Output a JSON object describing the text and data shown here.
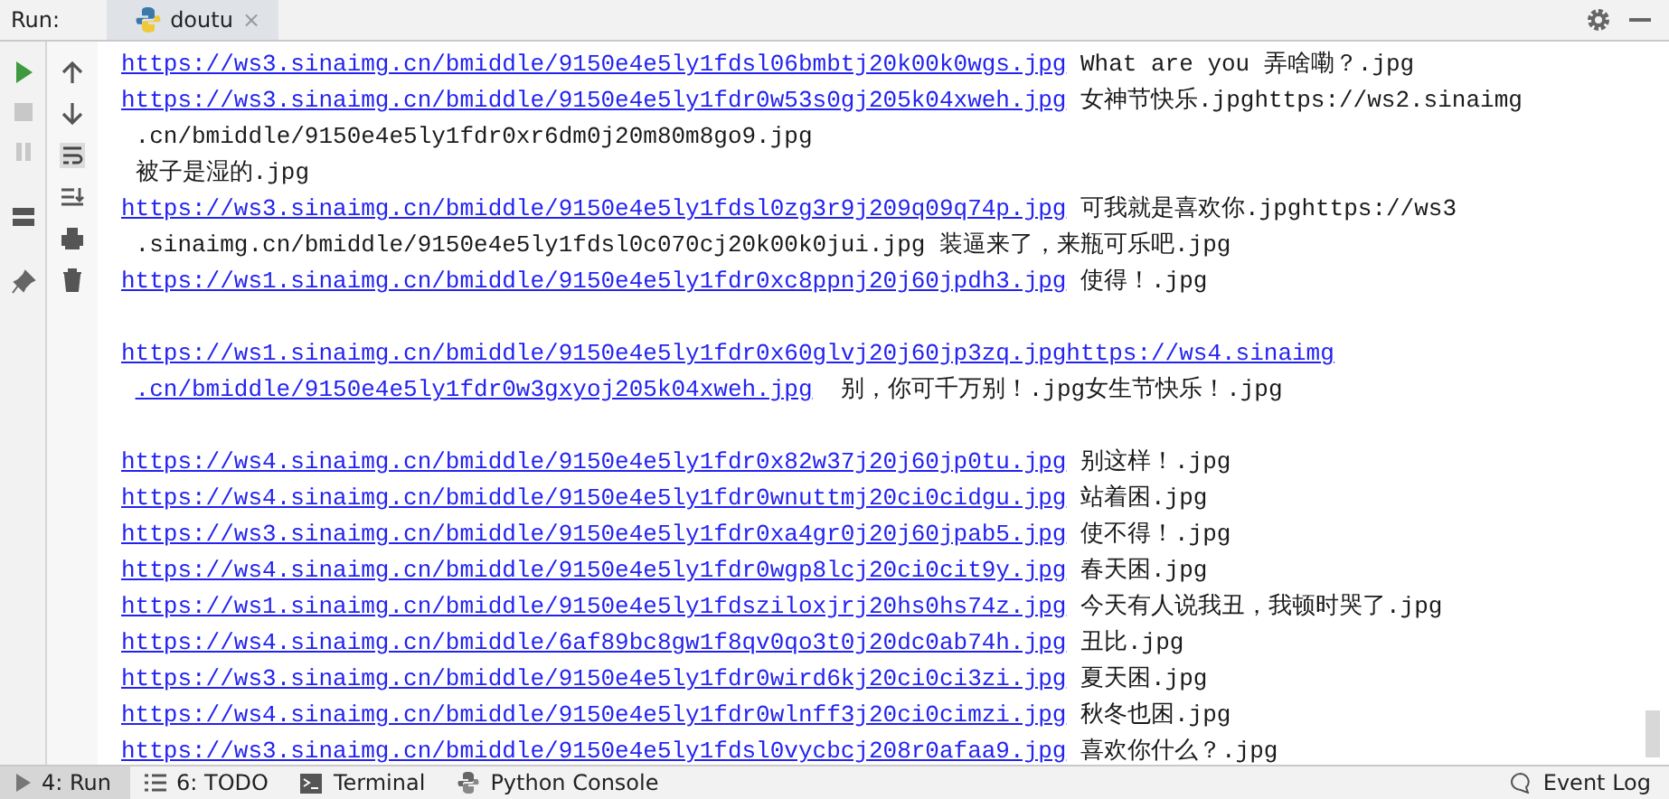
{
  "run_header": {
    "label": "Run:",
    "tabs": [
      {
        "title": "doutu",
        "selected": true,
        "close": "×"
      }
    ]
  },
  "console": {
    "lines": [
      {
        "kind": "output",
        "segments": [
          {
            "kind": "link",
            "text": "https://ws3.sinaimg.cn/bmiddle/9150e4e5ly1fdsl06bmbtj20k00k0wgs.jpg"
          },
          {
            "kind": "text",
            "text": " What are you 弄啥嘞？.jpg"
          }
        ]
      },
      {
        "kind": "output",
        "segments": [
          {
            "kind": "link",
            "text": "https://ws3.sinaimg.cn/bmiddle/9150e4e5ly1fdr0w53s0gj205k04xweh.jpg"
          },
          {
            "kind": "text",
            "text": " 女神节快乐.jpghttps://ws2.sinaimg"
          }
        ]
      },
      {
        "kind": "output",
        "segments": [
          {
            "kind": "text",
            "text": " .cn/bmiddle/9150e4e5ly1fdr0xr6dm0j20m80m8go9.jpg"
          }
        ]
      },
      {
        "kind": "output",
        "segments": [
          {
            "kind": "text",
            "text": " 被子是湿的.jpg"
          }
        ]
      },
      {
        "kind": "output",
        "segments": [
          {
            "kind": "link",
            "text": "https://ws3.sinaimg.cn/bmiddle/9150e4e5ly1fdsl0zg3r9j209q09q74p.jpg"
          },
          {
            "kind": "text",
            "text": " 可我就是喜欢你.jpghttps://ws3"
          }
        ]
      },
      {
        "kind": "output",
        "segments": [
          {
            "kind": "text",
            "text": " .sinaimg.cn/bmiddle/9150e4e5ly1fdsl0c070cj20k00k0jui.jpg 装逼来了，来瓶可乐吧.jpg"
          }
        ]
      },
      {
        "kind": "output",
        "segments": [
          {
            "kind": "link",
            "text": "https://ws1.sinaimg.cn/bmiddle/9150e4e5ly1fdr0xc8ppnj20j60jpdh3.jpg"
          },
          {
            "kind": "text",
            "text": " 使得！.jpg"
          }
        ]
      },
      {
        "kind": "blank"
      },
      {
        "kind": "output",
        "segments": [
          {
            "kind": "link",
            "text": "https://ws1.sinaimg.cn/bmiddle/9150e4e5ly1fdr0x60glvj20j60jp3zq.jpghttps://ws4.sinaimg"
          }
        ]
      },
      {
        "kind": "output",
        "continued": true,
        "segments": [
          {
            "kind": "link",
            "text": ".cn/bmiddle/9150e4e5ly1fdr0w3gxyoj205k04xweh.jpg"
          },
          {
            "kind": "text",
            "text": "  别，你可千万别！.jpg女生节快乐！.jpg"
          }
        ]
      },
      {
        "kind": "blank"
      },
      {
        "kind": "output",
        "segments": [
          {
            "kind": "link",
            "text": "https://ws4.sinaimg.cn/bmiddle/9150e4e5ly1fdr0x82w37j20j60jp0tu.jpg"
          },
          {
            "kind": "text",
            "text": " 别这样！.jpg"
          }
        ]
      },
      {
        "kind": "output",
        "segments": [
          {
            "kind": "link",
            "text": "https://ws4.sinaimg.cn/bmiddle/9150e4e5ly1fdr0wnuttmj20ci0cidgu.jpg"
          },
          {
            "kind": "text",
            "text": " 站着困.jpg"
          }
        ]
      },
      {
        "kind": "output",
        "segments": [
          {
            "kind": "link",
            "text": "https://ws3.sinaimg.cn/bmiddle/9150e4e5ly1fdr0xa4gr0j20j60jpab5.jpg"
          },
          {
            "kind": "text",
            "text": " 使不得！.jpg"
          }
        ]
      },
      {
        "kind": "output",
        "segments": [
          {
            "kind": "link",
            "text": "https://ws4.sinaimg.cn/bmiddle/9150e4e5ly1fdr0wgp8lcj20ci0cit9y.jpg"
          },
          {
            "kind": "text",
            "text": " 春天困.jpg"
          }
        ]
      },
      {
        "kind": "output",
        "segments": [
          {
            "kind": "link",
            "text": "https://ws1.sinaimg.cn/bmiddle/9150e4e5ly1fdsziloxjrj20hs0hs74z.jpg"
          },
          {
            "kind": "text",
            "text": " 今天有人说我丑，我顿时哭了.jpg"
          }
        ]
      },
      {
        "kind": "output",
        "segments": [
          {
            "kind": "link",
            "text": "https://ws4.sinaimg.cn/bmiddle/6af89bc8gw1f8qv0qo3t0j20dc0ab74h.jpg"
          },
          {
            "kind": "text",
            "text": " 丑比.jpg"
          }
        ]
      },
      {
        "kind": "output",
        "segments": [
          {
            "kind": "link",
            "text": "https://ws3.sinaimg.cn/bmiddle/9150e4e5ly1fdr0wird6kj20ci0ci3zi.jpg"
          },
          {
            "kind": "text",
            "text": " 夏天困.jpg"
          }
        ]
      },
      {
        "kind": "output",
        "segments": [
          {
            "kind": "link",
            "text": "https://ws4.sinaimg.cn/bmiddle/9150e4e5ly1fdr0wlnff3j20ci0cimzi.jpg"
          },
          {
            "kind": "text",
            "text": " 秋冬也困.jpg"
          }
        ]
      },
      {
        "kind": "output",
        "segments": [
          {
            "kind": "link",
            "text": "https://ws3.sinaimg.cn/bmiddle/9150e4e5ly1fdsl0vycbcj208r0afaa9.jpg"
          },
          {
            "kind": "text",
            "text": " 喜欢你什么？.jpg"
          }
        ]
      }
    ]
  },
  "status_bar": {
    "tools": [
      {
        "label": "4: Run",
        "kind": "run",
        "selected": true
      },
      {
        "label": "6: TODO",
        "kind": "todo",
        "selected": false
      },
      {
        "label": "Terminal",
        "kind": "terminal",
        "selected": false
      },
      {
        "label": "Python Console",
        "kind": "python-console",
        "selected": false
      }
    ],
    "event_log": "Event Log"
  }
}
